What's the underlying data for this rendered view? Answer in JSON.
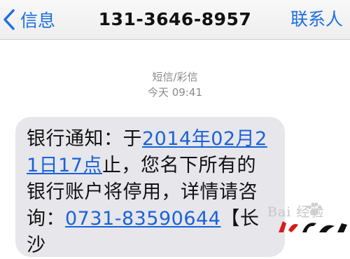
{
  "nav": {
    "back_label": "信息",
    "title": "131-3646-8957",
    "contacts_label": "联系人"
  },
  "meta": {
    "message_type": "短信/彩信",
    "timestamp": "今天 09:41"
  },
  "message": {
    "part1": "银行通知：于",
    "datetime_link": "2014年02月21日17点",
    "part2": "止，您名下所有的银行账户将停用，详情请咨询：",
    "phone_link": "0731-83590644",
    "part3": "【长沙"
  },
  "watermark": {
    "text": "Bai 经验"
  },
  "colors": {
    "accent": "#1d6fe0",
    "link": "#1a62d8",
    "bubble": "#e6e6eb",
    "meta_text": "#8a8a8a",
    "stamp_red": "#d61d1d"
  }
}
